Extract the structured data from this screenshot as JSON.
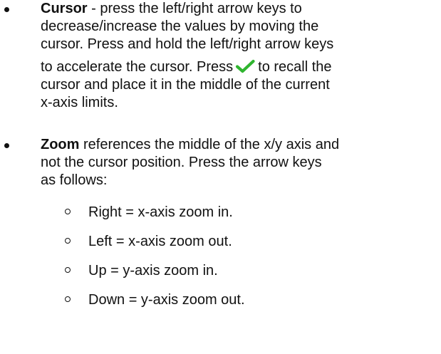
{
  "cursor_item": {
    "term": "Cursor",
    "line1_rest": " - press the left/right arrow keys to",
    "line2": "decrease/increase the values by moving the",
    "line3": "cursor. Press and hold the left/right arrow keys",
    "line4_before_icon": "to accelerate the cursor. Press",
    "line4_after_icon": "to recall the",
    "line5": "cursor and place it in the middle of the current",
    "line6": "x-axis limits."
  },
  "zoom_item": {
    "term": "Zoom",
    "line1_rest": " references the middle of the x/y axis and",
    "line2": "not the cursor position. Press the arrow keys",
    "line3": "as follows:",
    "sub_items": [
      "Right = x-axis zoom in.",
      "Left = x-axis zoom out.",
      "Up = y-axis zoom in.",
      "Down = y-axis zoom out."
    ]
  },
  "icons": {
    "bullet": "filled-circle-bullet",
    "sub_bullet": "hollow-circle-bullet",
    "confirm": "green-checkmark-icon"
  },
  "colors": {
    "text": "#111111",
    "checkmark": "#2fb52f"
  }
}
